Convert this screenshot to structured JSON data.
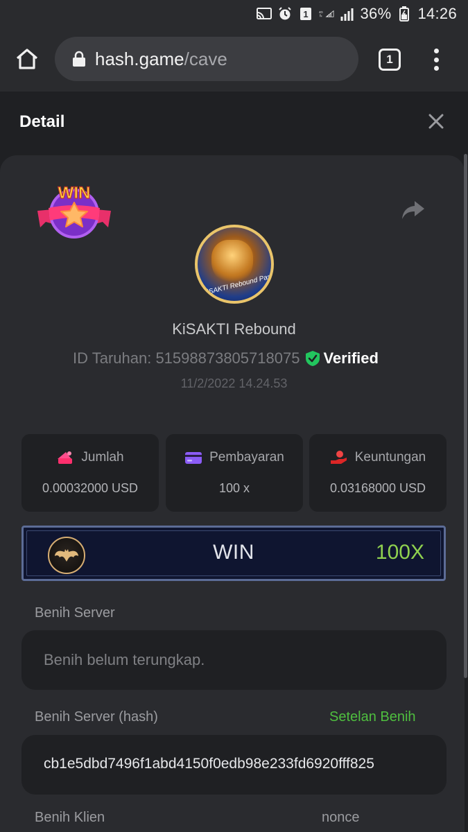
{
  "status_bar": {
    "battery": "36%",
    "time": "14:26",
    "notification_count": "1",
    "network": "4G"
  },
  "browser": {
    "url_host": "hash.game",
    "url_path": "/cave",
    "tab_count": "1"
  },
  "detail": {
    "title": "Detail"
  },
  "game": {
    "badge_text": "WIN",
    "avatar_text": "KiSAKTI Rebound Pass",
    "name": "KiSAKTI Rebound",
    "bet_id": "ID Taruhan: 515988738057180​75",
    "verified": "Verified",
    "datetime": "11/2/2022 14.24.53"
  },
  "stats": [
    {
      "label": "Jumlah",
      "value": "0.00032000 USD",
      "icon": "coins-icon"
    },
    {
      "label": "Pembayaran",
      "value": "100 x",
      "icon": "card-icon"
    },
    {
      "label": "Keuntungan",
      "value": "0.03168000 USD",
      "icon": "hand-coin-icon"
    }
  ],
  "result": {
    "label": "WIN",
    "multiplier": "100X",
    "icon": "bat-icon"
  },
  "seeds": {
    "server_label": "Benih Server",
    "server_value": "Benih belum terungkap.",
    "server_hash_label": "Benih Server (hash)",
    "seed_settings_link": "Setelan Benih",
    "server_hash_value": "cb1e5dbd7496f1abd4150f0edb98e233fd6920fff825",
    "client_label": "Benih Klien",
    "nonce_label": "nonce"
  },
  "colors": {
    "accent_green": "#4fbf3f",
    "multiplier_green": "#8fd14f",
    "background": "#1f2023",
    "panel": "#2a2b2f"
  }
}
